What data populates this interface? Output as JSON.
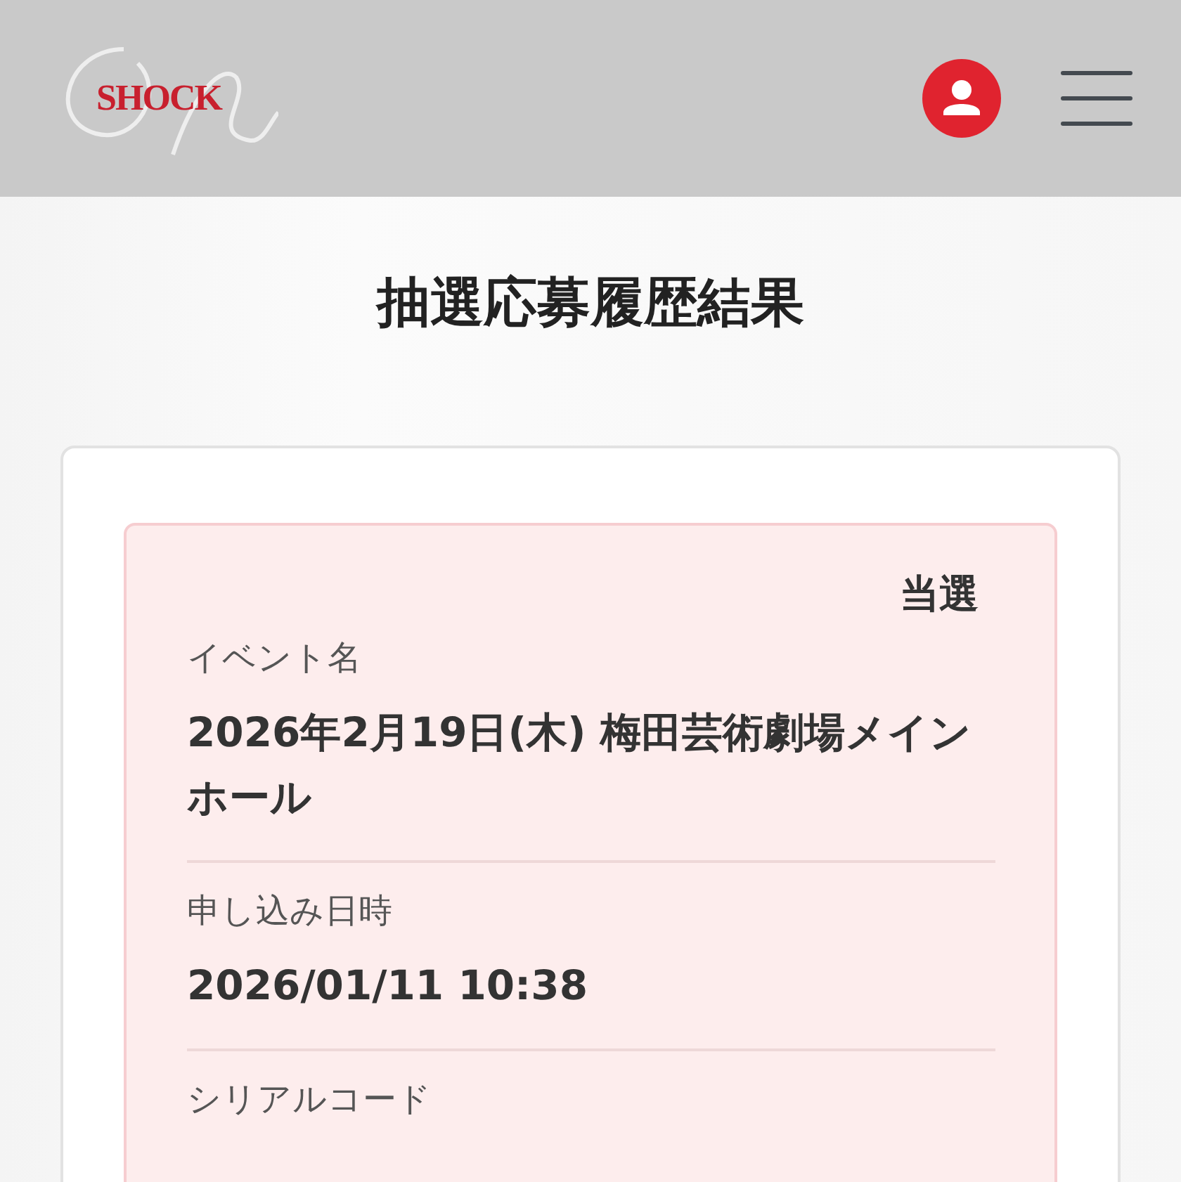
{
  "header": {
    "logo_text": "SHOCK"
  },
  "title": "抽選応募履歴結果",
  "entry": {
    "status": "当選",
    "won": true,
    "fields": [
      {
        "label": "イベント名",
        "value": "2026年2月19日(木) 梅田芸術劇場メインホール"
      },
      {
        "label": "申し込み日時",
        "value": "2026/01/11 10:38"
      },
      {
        "label": "シリアルコード"
      }
    ]
  }
}
